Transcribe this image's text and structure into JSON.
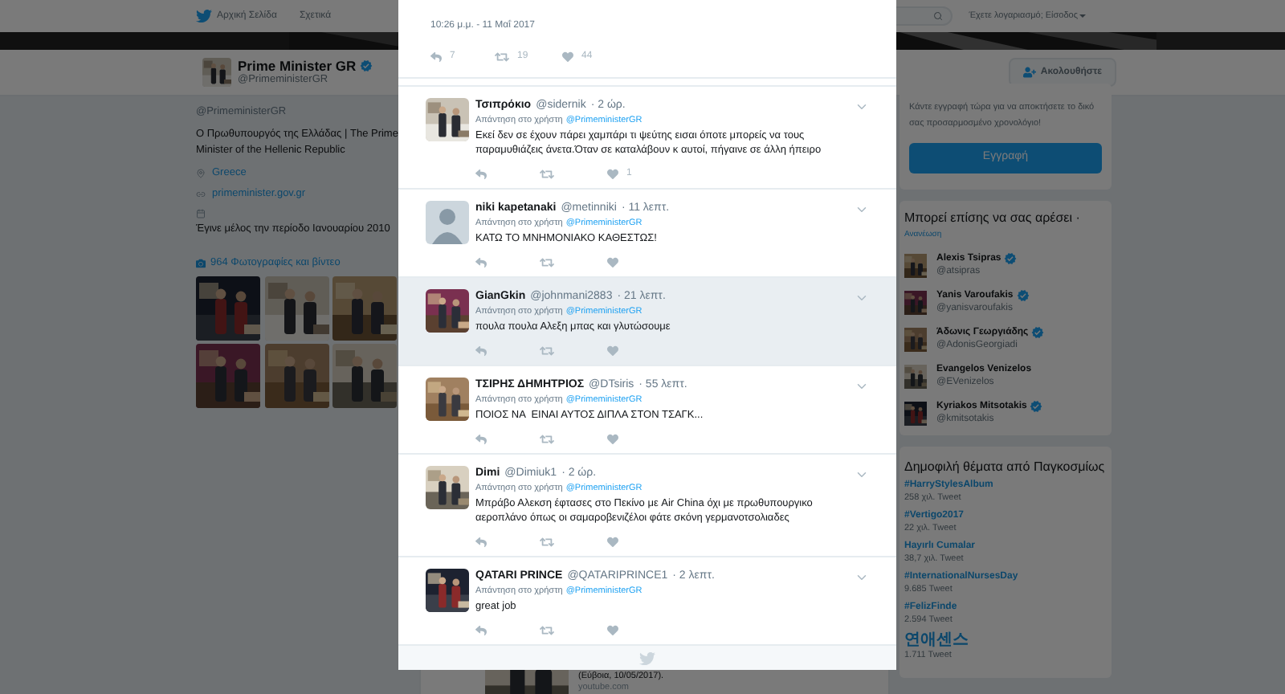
{
  "nav": {
    "home": "Αρχική Σελίδα",
    "about": "Σχετικά",
    "account": "Έχετε λογαριασμό; Είσοδος"
  },
  "profile": {
    "name": "Prime Minister GR",
    "verified": true,
    "handle": "@PrimeministerGR",
    "follow": "Ακολουθήστε",
    "screen_name": "@PrimeministerGR",
    "bio": "Ο Πρωθυπουργός της Ελλάδας | The Prime Minister of the Hellenic Republic",
    "location": "Greece",
    "website": "primeminister.gov.gr",
    "joined": "Έγινε μέλος την περίοδο Ιανουαρίου 2010",
    "photos_label": "964 Φωτογραφίες και βίντεο"
  },
  "timeline_card": {
    "caption": "(Εύβοια, 10/05/2017).",
    "source": "youtube.com"
  },
  "modal": {
    "timestamp": "10:26 μ.μ. - 11 Μαΐ 2017",
    "stats": {
      "replies": "7",
      "retweets": "19",
      "likes": "44"
    },
    "replies": [
      {
        "name": "Τσιπρόκιο",
        "handle": "@sidernik",
        "time": "· 2 ώρ.",
        "reply_label": "Απάντηση στο χρήστη",
        "reply_to": "@PrimeministerGR",
        "text": "Εκεί δεν σε έχουν πάρει χαμπάρι τι ψεύτης εισαι όποτε μπορείς να τους παραμυθιάζεις άνετα.Όταν σε καταλάβουν κ αυτοί, πήγαινε σε άλλη ήπειρο",
        "likes": "1",
        "highlighted": false
      },
      {
        "name": "niki kapetanaki",
        "handle": "@metinniki",
        "time": "· 11 λεπτ.",
        "reply_label": "Απάντηση στο χρήστη",
        "reply_to": "@PrimeministerGR",
        "text": "ΚΑΤΩ ΤΟ ΜΝΗΜΟΝΙΑΚΟ ΚΑΘΕΣΤΩΣ!",
        "highlighted": false,
        "avatar": {
          "kind": "default"
        }
      },
      {
        "name": "GianGkin",
        "handle": "@johnmani2883",
        "time": "· 21 λεπτ.",
        "reply_label": "Απάντηση στο χρήστη",
        "reply_to": "@PrimeministerGR",
        "text": "πουλα πουλα Αλεξη μπας και γλυτώσουμε",
        "highlighted": true
      },
      {
        "name": "ΤΣΙΡΗΣ ΔΗΜΗΤΡΙΟΣ",
        "handle": "@DTsiris",
        "time": "· 55 λεπτ.",
        "reply_label": "Απάντηση στο χρήστη",
        "reply_to": "@PrimeministerGR",
        "text": "ΠΟΙΟΣ ΝΑ  ΕΙΝΑΙ ΑΥΤΟΣ ΔΙΠΛΑ ΣΤΟΝ ΤΣΑΓΚ...",
        "highlighted": false
      },
      {
        "name": "Dimi",
        "handle": "@Dimiuk1",
        "time": "· 2 ώρ.",
        "reply_label": "Απάντηση στο χρήστη",
        "reply_to": "@PrimeministerGR",
        "text": "Μπράβο Αλεκση έφτασες στο Πεκίνο με Air China όχι με πρωθυπουργικο αεροπλάνο όπως οι σαμαροβενιζέλοι φάτε σκόνη γερμανοτσολιαδες",
        "highlighted": false
      },
      {
        "name": "QATARI PRINCE",
        "handle": "@QATARIPRINCE1",
        "time": "· 2 λεπτ.",
        "reply_label": "Απάντηση στο χρήστη",
        "reply_to": "@PrimeministerGR",
        "text": "great job",
        "highlighted": false
      }
    ]
  },
  "signup": {
    "text": "Κάντε εγγραφή τώρα για να αποκτήσετε το δικό σας προσαρμοσμένο χρονολόγιο!",
    "button": "Εγγραφή"
  },
  "suggestions": {
    "title": "Μπορεί επίσης να σας αρέσει ·",
    "refresh": "Ανανέωση",
    "people": [
      {
        "name": "Alexis Tsipras",
        "handle": "@atsipras",
        "verified": true
      },
      {
        "name": "Yanis Varoufakis",
        "handle": "@yanisvaroufakis",
        "verified": true
      },
      {
        "name": "Άδωνις Γεωργιάδης",
        "handle": "@AdonisGeorgiadi",
        "verified": true
      },
      {
        "name": "Evangelos Venizelos",
        "handle": "@EVenizelos",
        "verified": false
      },
      {
        "name": "Kyriakos Mitsotakis",
        "handle": "@kmitsotakis",
        "verified": true
      }
    ]
  },
  "trends": {
    "title": "Δημοφιλή θέματα από Παγκοσμίως",
    "items": [
      {
        "name": "#HarryStylesAlbum",
        "count": "258 χιλ. Tweet",
        "kind": "latin"
      },
      {
        "name": "#Vertigo2017",
        "count": "22 χιλ. Tweet",
        "kind": "latin"
      },
      {
        "name": "Hayırlı Cumalar",
        "count": "38,7 χιλ. Tweet",
        "kind": "latin"
      },
      {
        "name": "#InternationalNursesDay",
        "count": "9.685 Tweet",
        "kind": "latin"
      },
      {
        "name": "#FelizFinde",
        "count": "2.594 Tweet",
        "kind": "latin"
      },
      {
        "name": "연애센스",
        "count": "1.711 Tweet",
        "kind": "hangul"
      }
    ]
  }
}
